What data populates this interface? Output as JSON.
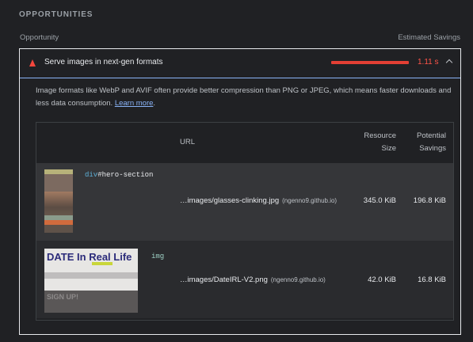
{
  "section": {
    "title": "OPPORTUNITIES"
  },
  "columns": {
    "left": "Opportunity",
    "right": "Estimated Savings"
  },
  "audit": {
    "title": "Serve images in next-gen formats",
    "savings": "1.11 s",
    "description_text": "Image formats like WebP and AVIF often provide better compression than PNG or JPEG, which means faster downloads and less data consumption.",
    "learn_more": "Learn more",
    "period": "."
  },
  "table": {
    "headers": {
      "url": "URL",
      "size_line1": "Resource",
      "size_line2": "Size",
      "savings_line1": "Potential",
      "savings_line2": "Savings"
    },
    "rows": [
      {
        "node_tag": "div",
        "node_id": "#hero-section",
        "url": "…images/glasses-clinking.jpg",
        "host": "(ngenno9.github.io)",
        "size": "345.0 KiB",
        "savings": "196.8 KiB"
      },
      {
        "node_tag": "img",
        "url": "…images/DateIRL-V2.png",
        "host": "(ngenno9.github.io)",
        "size": "42.0 KiB",
        "savings": "16.8 KiB",
        "thumb_logo": "DATE In Real Life",
        "thumb_heading": "SIGN UP!"
      }
    ]
  },
  "colors": {
    "background": "#202124",
    "fail": "#ff5449",
    "link": "#8ab4f8"
  }
}
